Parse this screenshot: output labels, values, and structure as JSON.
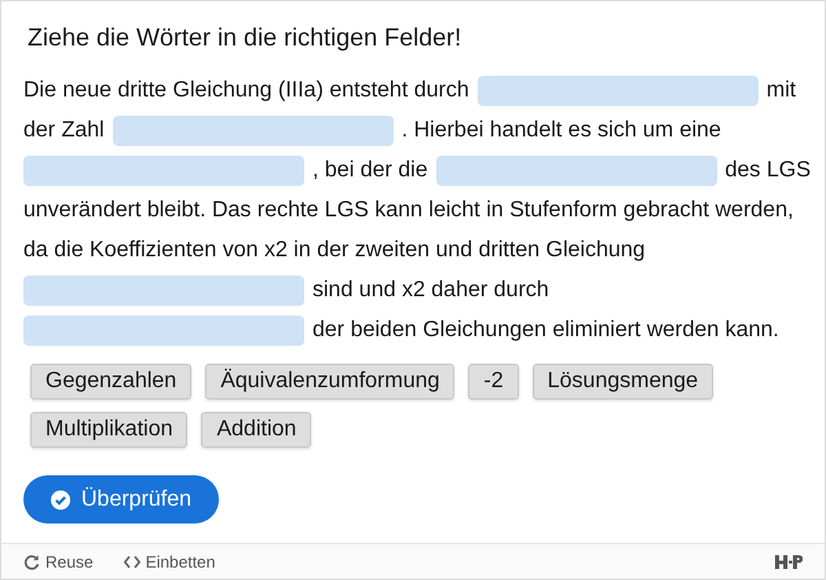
{
  "title": "Ziehe die Wörter in die richtigen Felder!",
  "lines": [
    [
      {
        "kind": "text",
        "text": "Die neue dritte Gleichung (IIIa) entsteht durch"
      },
      {
        "kind": "blank"
      },
      {
        "kind": "text",
        "text": "mit"
      }
    ],
    [
      {
        "kind": "text",
        "text": "der Zahl"
      },
      {
        "kind": "blank"
      },
      {
        "kind": "text",
        "text": ". Hierbei handelt es sich um eine"
      }
    ],
    [
      {
        "kind": "blank"
      },
      {
        "kind": "text",
        "text": ", bei der die"
      },
      {
        "kind": "blank"
      },
      {
        "kind": "text",
        "text": "des LGS"
      }
    ],
    [
      {
        "kind": "text",
        "text": "unverändert bleibt. Das rechte LGS kann leicht in Stufenform gebracht werden,"
      }
    ],
    [
      {
        "kind": "text",
        "text": "da die Koeffizienten von x2 in der zweiten und dritten Gleichung"
      }
    ],
    [
      {
        "kind": "blank"
      },
      {
        "kind": "text",
        "text": "sind und x2 daher durch"
      }
    ],
    [
      {
        "kind": "blank"
      },
      {
        "kind": "text",
        "text": "der beiden Gleichungen eliminiert werden kann."
      }
    ]
  ],
  "words": [
    "Gegenzahlen",
    "Äquivalenzumformung",
    "-2",
    "Lösungsmenge",
    "Multiplikation",
    "Addition"
  ],
  "check_button": "Überprüfen",
  "footer": {
    "reuse": "Reuse",
    "embed": "Einbetten"
  }
}
